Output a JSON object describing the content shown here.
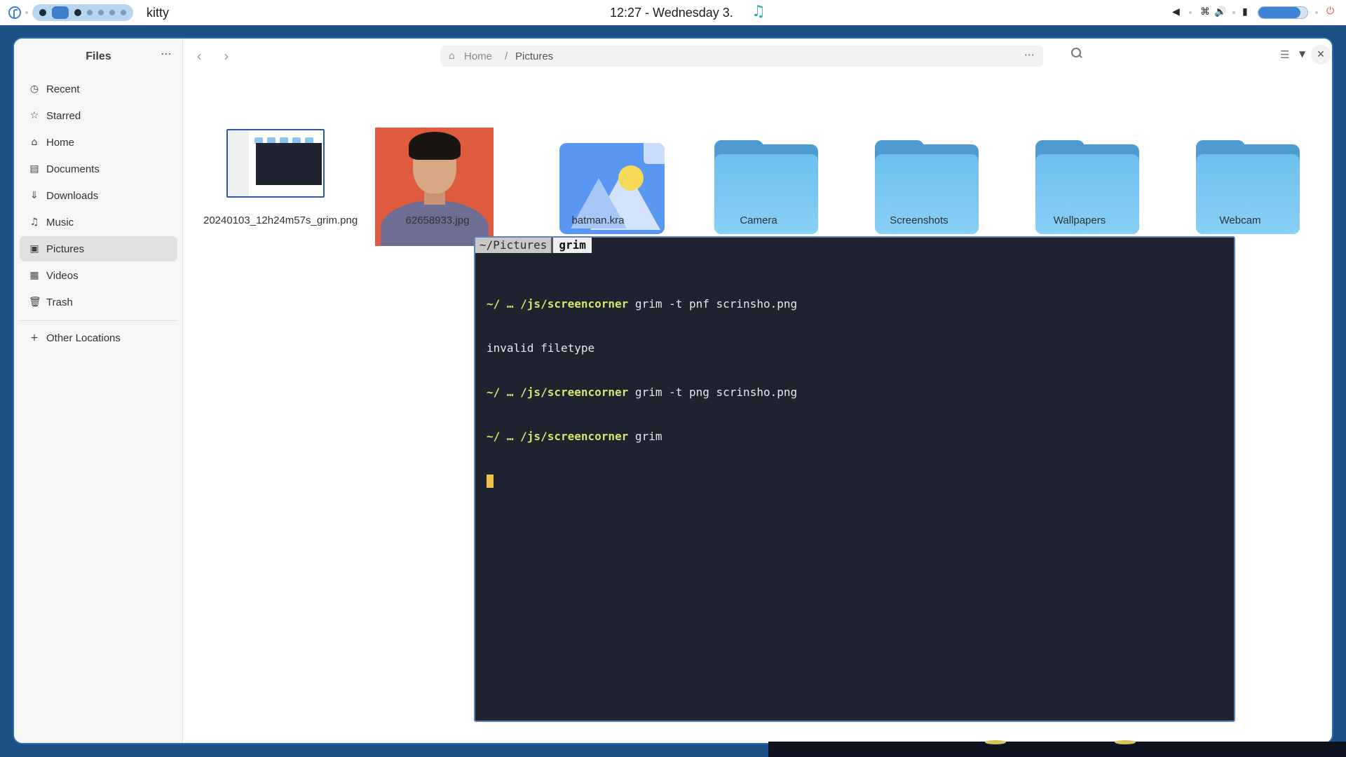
{
  "topbar": {
    "app_title": "kitty",
    "clock": "12:27 - Wednesday  3.",
    "music_icon": "music-note-icon",
    "battery_level": 0.85
  },
  "files": {
    "sidebar": {
      "title": "Files",
      "menu_label": "⋯",
      "items": [
        {
          "label": "Recent",
          "icon": "clock-icon"
        },
        {
          "label": "Starred",
          "icon": "star-icon"
        },
        {
          "label": "Home",
          "icon": "home-icon"
        },
        {
          "label": "Documents",
          "icon": "document-icon"
        },
        {
          "label": "Downloads",
          "icon": "download-icon"
        },
        {
          "label": "Music",
          "icon": "music-icon"
        },
        {
          "label": "Pictures",
          "icon": "image-icon",
          "active": true
        },
        {
          "label": "Videos",
          "icon": "film-icon"
        },
        {
          "label": "Trash",
          "icon": "trash-icon"
        }
      ],
      "other_locations": "Other Locations"
    },
    "pathbar": {
      "home": "Home",
      "separator": "/",
      "current": "Pictures",
      "more": "⋯"
    },
    "grid": [
      {
        "label": "20240103_12h24m57s_grim.png",
        "kind": "screenshot-thumbnail"
      },
      {
        "label": "62658933.jpg",
        "kind": "photo-thumbnail"
      },
      {
        "label": "batman.kra",
        "kind": "image-file-icon"
      },
      {
        "label": "Camera",
        "kind": "folder"
      },
      {
        "label": "Screenshots",
        "kind": "folder"
      },
      {
        "label": "Wallpapers",
        "kind": "folder"
      },
      {
        "label": "Webcam",
        "kind": "folder"
      }
    ]
  },
  "terminal": {
    "tab_inactive": "~/Pictures ",
    "tab_active": "grim",
    "lines": [
      {
        "prompt": "~/ … /js/screencorner",
        "command": " grim -t pnf scrinsho.png"
      },
      {
        "output": "invalid filetype"
      },
      {
        "prompt": "~/ … /js/screencorner",
        "command": " grim -t png scrinsho.png"
      },
      {
        "prompt": "~/ … /js/screencorner",
        "command": " grim"
      }
    ]
  },
  "colors": {
    "desktop_bg": "#1b4f86",
    "accent": "#3d7fcc",
    "terminal_bg": "#1f2330",
    "prompt": "#d7e36a",
    "cursor": "#f0c14a",
    "folder": "#6cc0ee"
  }
}
